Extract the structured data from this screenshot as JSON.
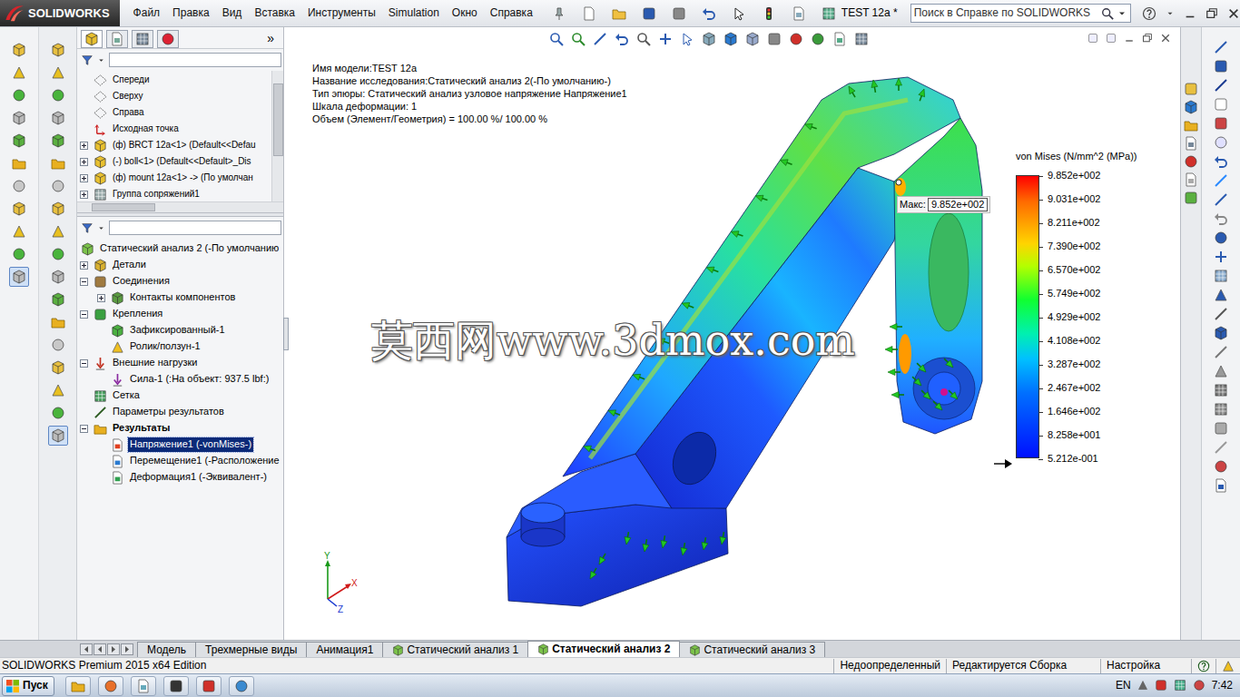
{
  "app": {
    "logo": "SOLIDWORKS",
    "document_title": "TEST 12a *"
  },
  "menu": [
    "Файл",
    "Правка",
    "Вид",
    "Вставка",
    "Инструменты",
    "Simulation",
    "Окно",
    "Справка"
  ],
  "search": {
    "placeholder": "Поиск в Справке по SOLIDWORKS"
  },
  "left_toolbar": {
    "col1": [
      {
        "pressed": false
      },
      {
        "pressed": false
      },
      {
        "pressed": false
      },
      {
        "pressed": false
      },
      {
        "pressed": false
      },
      {
        "pressed": false
      },
      {
        "pressed": false
      },
      {
        "pressed": false
      },
      {
        "pressed": false
      },
      {
        "pressed": false
      },
      {
        "pressed": true
      }
    ],
    "col2": [
      {
        "pressed": false
      },
      {
        "pressed": false
      },
      {
        "pressed": false
      },
      {
        "pressed": false
      },
      {
        "pressed": false
      },
      {
        "pressed": false
      },
      {
        "pressed": false
      },
      {
        "pressed": false
      },
      {
        "pressed": false
      },
      {
        "pressed": false
      },
      {
        "pressed": false
      },
      {
        "pressed": false
      },
      {
        "pressed": false
      },
      {
        "pressed": false
      },
      {
        "pressed": false
      },
      {
        "pressed": false
      },
      {
        "pressed": false
      },
      {
        "pressed": true
      }
    ]
  },
  "feature_tree": {
    "more": "»",
    "items": [
      {
        "label": "Спереди",
        "kind": "plane",
        "depth": 1,
        "expandable": false,
        "expanded": false,
        "selected": false,
        "bold": false
      },
      {
        "label": "Сверху",
        "kind": "plane",
        "depth": 1,
        "expandable": false,
        "expanded": false,
        "selected": false,
        "bold": false
      },
      {
        "label": "Справа",
        "kind": "plane",
        "depth": 1,
        "expandable": false,
        "expanded": false,
        "selected": false,
        "bold": false
      },
      {
        "label": "Исходная точка",
        "kind": "origin",
        "depth": 1,
        "expandable": false,
        "expanded": false,
        "selected": false,
        "bold": false
      },
      {
        "label": "(ф) BRCT 12a<1> (Default<<Defau",
        "kind": "part",
        "depth": 1,
        "expandable": true,
        "expanded": false,
        "selected": false,
        "bold": false
      },
      {
        "label": "(-) boll<1> (Default<<Default>_Dis",
        "kind": "part",
        "depth": 1,
        "expandable": true,
        "expanded": false,
        "selected": false,
        "bold": false
      },
      {
        "label": "(ф) mount 12a<1> -> (По умолчан",
        "kind": "part",
        "depth": 1,
        "expandable": true,
        "expanded": false,
        "selected": false,
        "bold": false
      },
      {
        "label": "Группа сопряжений1",
        "kind": "mates",
        "depth": 1,
        "expandable": true,
        "expanded": false,
        "selected": false,
        "bold": false
      }
    ]
  },
  "study_tree": {
    "items": [
      {
        "label": "Статический анализ 2 (-По умолчанию",
        "kind": "study",
        "depth": 0,
        "expandable": false,
        "expanded": true,
        "selected": false,
        "bold": false
      },
      {
        "label": "Детали",
        "kind": "parts",
        "depth": 1,
        "expandable": true,
        "expanded": false,
        "selected": false,
        "bold": false
      },
      {
        "label": "Соединения",
        "kind": "connections",
        "depth": 1,
        "expandable": true,
        "expanded": true,
        "selected": false,
        "bold": false
      },
      {
        "label": "Контакты компонентов",
        "kind": "contacts",
        "depth": 2,
        "expandable": true,
        "expanded": false,
        "selected": false,
        "bold": false
      },
      {
        "label": "Крепления",
        "kind": "fixtures",
        "depth": 1,
        "expandable": true,
        "expanded": true,
        "selected": false,
        "bold": false
      },
      {
        "label": "Зафиксированный-1",
        "kind": "fixed",
        "depth": 2,
        "expandable": false,
        "expanded": false,
        "selected": false,
        "bold": false
      },
      {
        "label": "Ролик/ползун-1",
        "kind": "roller",
        "depth": 2,
        "expandable": false,
        "expanded": false,
        "selected": false,
        "bold": false
      },
      {
        "label": "Внешние нагрузки",
        "kind": "loads",
        "depth": 1,
        "expandable": true,
        "expanded": true,
        "selected": false,
        "bold": false
      },
      {
        "label": "Сила-1 (:На объект: 937.5 lbf:)",
        "kind": "force",
        "depth": 2,
        "expandable": false,
        "expanded": false,
        "selected": false,
        "bold": false
      },
      {
        "label": "Сетка",
        "kind": "mesh",
        "depth": 1,
        "expandable": false,
        "expanded": false,
        "selected": false,
        "bold": false
      },
      {
        "label": "Параметры результатов",
        "kind": "params",
        "depth": 1,
        "expandable": false,
        "expanded": false,
        "selected": false,
        "bold": false
      },
      {
        "label": "Результаты",
        "kind": "results",
        "depth": 1,
        "expandable": true,
        "expanded": true,
        "selected": false,
        "bold": true
      },
      {
        "label": "Напряжение1 (-vonMises-)",
        "kind": "stress",
        "depth": 2,
        "expandable": false,
        "expanded": false,
        "selected": true,
        "bold": false
      },
      {
        "label": "Перемещение1 (-Расположение",
        "kind": "displacement",
        "depth": 2,
        "expandable": false,
        "expanded": false,
        "selected": false,
        "bold": false
      },
      {
        "label": "Деформация1 (-Эквивалент-)",
        "kind": "strain",
        "depth": 2,
        "expandable": false,
        "expanded": false,
        "selected": false,
        "bold": false
      }
    ]
  },
  "graphics": {
    "info": [
      "Имя модели:TEST 12a",
      "Название исследования:Статический анализ 2(-По умолчанию-)",
      "Тип эпюры: Статический анализ узловое напряжение Напряжение1",
      "Шкала деформации: 1",
      "Объем (Элемент/Геометрия) = 100.00 %/ 100.00 %"
    ],
    "legend": {
      "title": "von Mises (N/mm^2 (MPa))",
      "ticks": [
        "9.852e+002",
        "9.031e+002",
        "8.211e+002",
        "7.390e+002",
        "6.570e+002",
        "5.749e+002",
        "4.929e+002",
        "4.108e+002",
        "3.287e+002",
        "2.467e+002",
        "1.646e+002",
        "8.258e+001",
        "5.212e-001"
      ]
    },
    "max_probe": {
      "label": "Макс:",
      "value": "9.852e+002"
    },
    "watermark": "莫西网www.3dmox.com",
    "triad": {
      "y": "Y",
      "x": "X",
      "z": "Z"
    }
  },
  "bottom_tabs": [
    {
      "label": "Модель",
      "kind": "model",
      "selected": false
    },
    {
      "label": "Трехмерные виды",
      "kind": "model",
      "selected": false
    },
    {
      "label": "Анимация1",
      "kind": "model",
      "selected": false
    },
    {
      "label": "Статический анализ 1",
      "kind": "study",
      "selected": false
    },
    {
      "label": "Статический анализ 2",
      "kind": "study",
      "selected": true
    },
    {
      "label": "Статический анализ 3",
      "kind": "study",
      "selected": false
    }
  ],
  "status_bar": {
    "edition": "SOLIDWORKS Premium 2015 x64 Edition",
    "fields": [
      "Недоопределенный",
      "Редактируется Сборка",
      "Настройка"
    ]
  },
  "taskbar": {
    "start": "Пуск",
    "language": "EN",
    "time": "7:42"
  }
}
